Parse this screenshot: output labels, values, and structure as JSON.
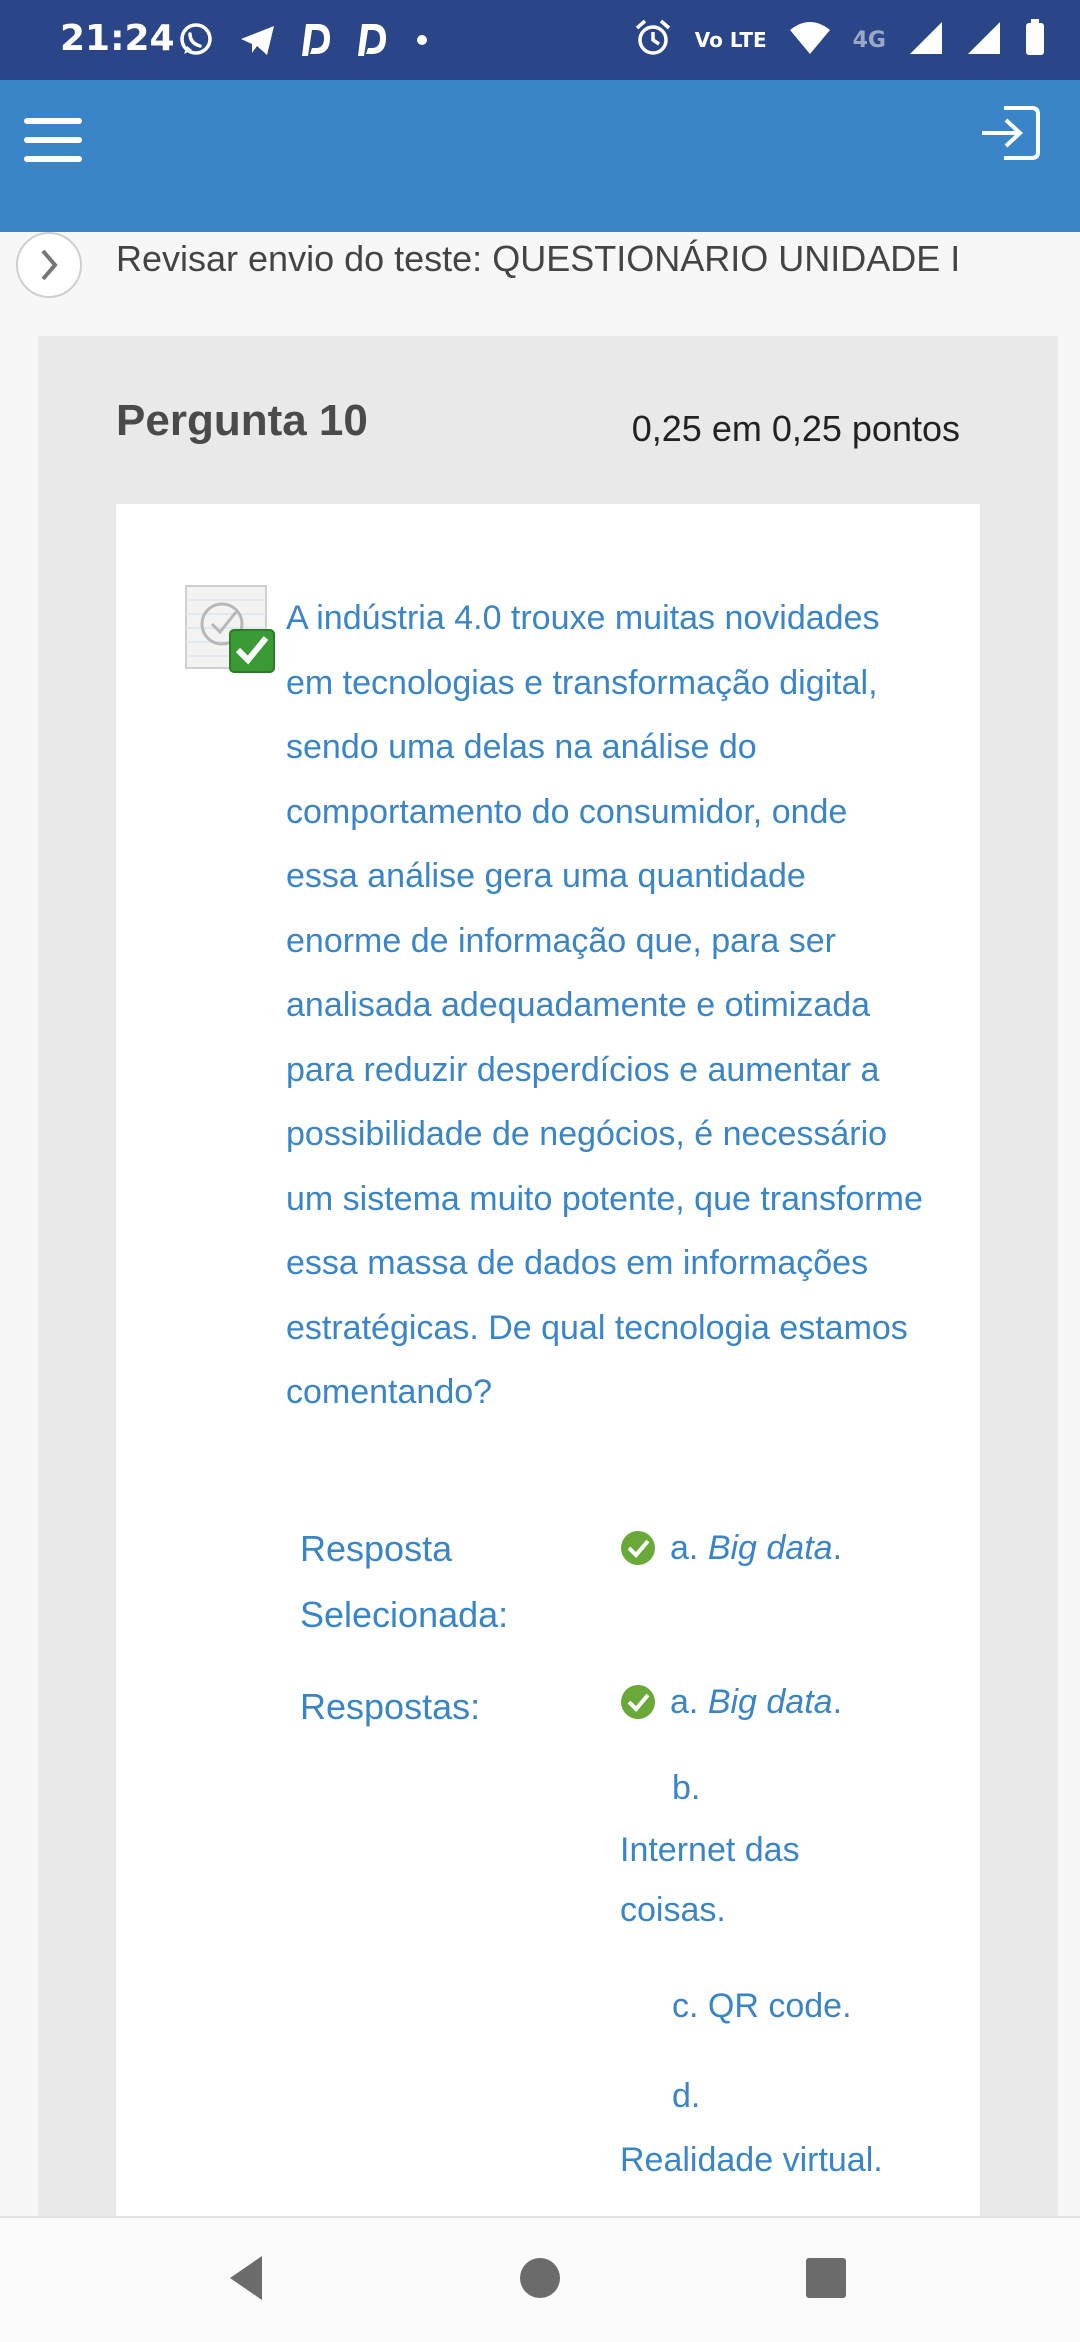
{
  "status_bar": {
    "time": "21:24",
    "left_icons": [
      "whatsapp-icon",
      "telegram-icon",
      "app-icon",
      "app-icon",
      "notification-dot-icon"
    ],
    "volte_label": "Vo LTE",
    "network_label": "4G",
    "right_icons": [
      "alarm-icon",
      "volte-icon",
      "wifi-icon",
      "signal-icon",
      "signal-icon",
      "battery-icon"
    ]
  },
  "header": {
    "menu_icon": "hamburger-menu-icon",
    "exit_icon": "exit-icon",
    "brand_color": "#3a85c8"
  },
  "page": {
    "title": "Revisar envio do teste: QUESTIONÁRIO UNIDADE I"
  },
  "question": {
    "title": "Pergunta 10",
    "points": "0,25 em 0,25 pontos",
    "text": "A indústria 4.0 trouxe muitas novidades em tecnologias e transformação digital, sendo uma delas na análise do comportamento do consumidor, onde essa análise gera uma quantidade enorme de informação que, para ser analisada adequadamente e otimizada para reduzir desperdícios e aumentar a possibilidade de negócios, é necessário um sistema muito potente, que transforme essa massa de dados em informações estratégicas. De qual tecnologia estamos comentando?",
    "selected_label_line1": "Resposta",
    "selected_label_line2": "Selecionada:",
    "selected_prefix": "a.",
    "selected_answer": "Big data",
    "answers_label": "Respostas:",
    "options": [
      {
        "letter": "a.",
        "text": "Big data",
        "correct": true
      },
      {
        "letter": "b.",
        "text": "Internet das coisas."
      },
      {
        "letter": "c.",
        "text": "QR code."
      },
      {
        "letter": "d.",
        "text": "Realidade virtual."
      }
    ]
  },
  "nav": {
    "back_icon": "back-triangle-icon",
    "home_icon": "home-circle-icon",
    "recent_icon": "recent-apps-square-icon"
  }
}
